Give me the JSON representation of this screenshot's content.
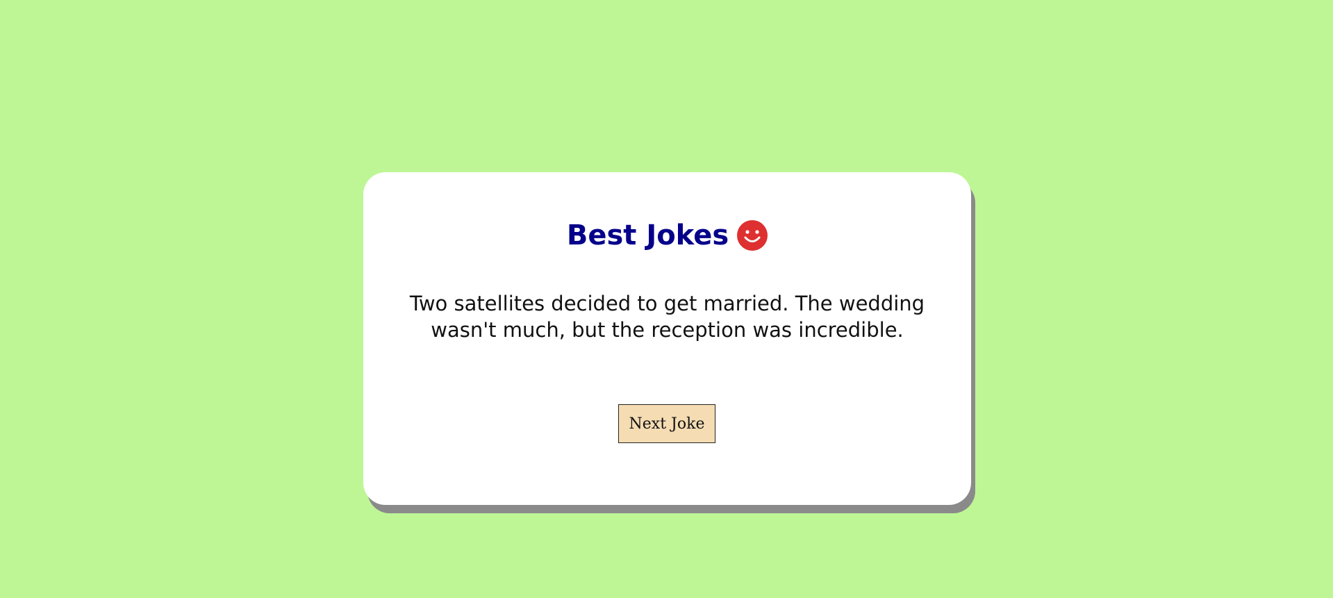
{
  "page": {
    "background_color": "#bef696"
  },
  "card": {
    "title": "Best Jokes",
    "title_color": "#05008a",
    "title_icon": "smiley-face-icon",
    "title_icon_color": "#de3030",
    "joke_text": "Two satellites decided to get married. The wedding wasn't much, but the reception was incredible.",
    "next_button_label": "Next Joke",
    "next_button_color": "#f5dcb3"
  }
}
